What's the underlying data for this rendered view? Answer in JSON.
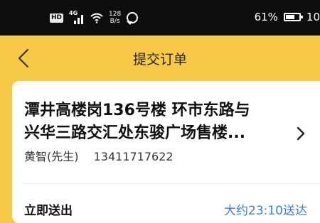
{
  "status_bar": {
    "network_badge": "HD",
    "network_type": "4G",
    "speed_value": "128",
    "speed_unit": "B/s",
    "battery_percent": "61%",
    "time": "10"
  },
  "nav": {
    "title": "提交订单"
  },
  "address_card": {
    "address_line1": "潭井高楼岗136号楼 环市东路与",
    "address_line2": "兴华三路交汇处东骏广场售楼...",
    "contact_name": "黄智(先生)",
    "phone": "13411717622",
    "delivery_label": "立即送出",
    "eta": "大约23:10送达"
  },
  "colors": {
    "background": "#F8C946",
    "status_bar": "#0E0E0E",
    "link": "#3C7DD6"
  }
}
